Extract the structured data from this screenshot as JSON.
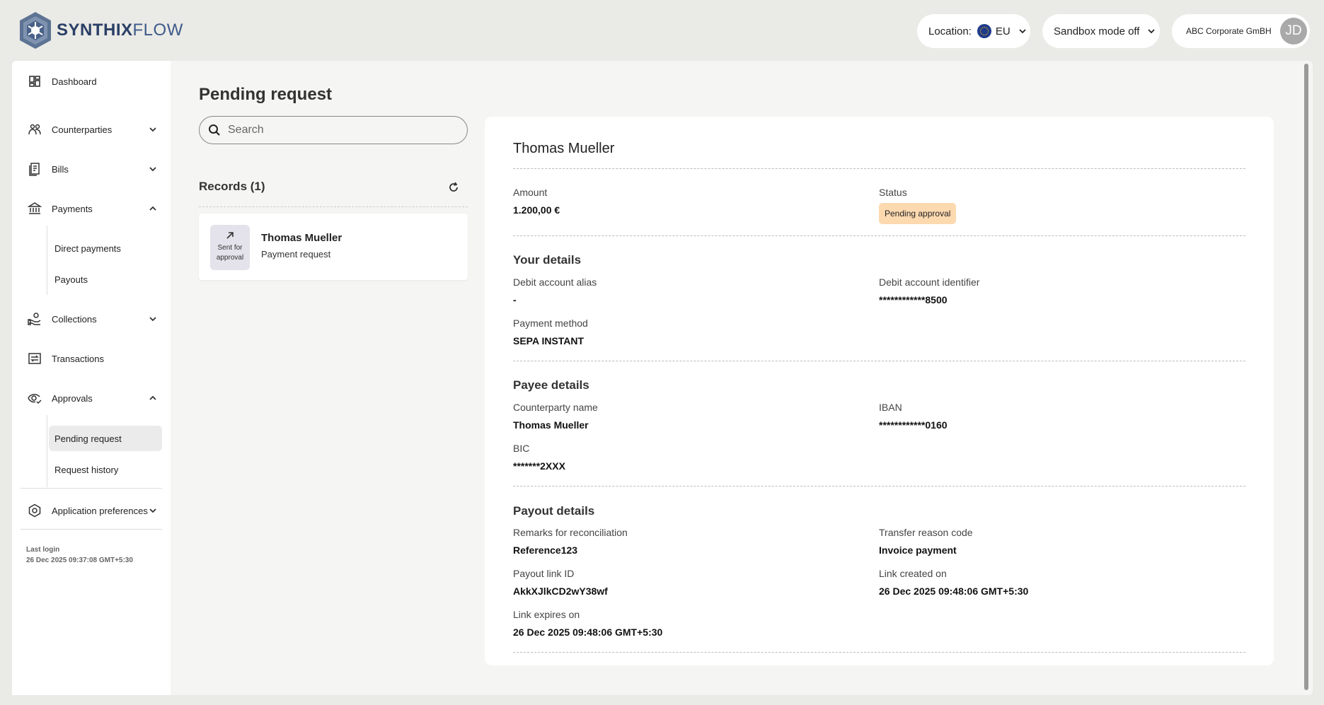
{
  "brand": {
    "name_bold": "SYNTHIX",
    "name_light": "FLOW"
  },
  "topbar": {
    "location_label": "Location:",
    "location_value": "EU",
    "sandbox_label": "Sandbox mode off",
    "company": "ABC Corporate GmBH",
    "avatar_initials": "JD"
  },
  "sidebar": {
    "dashboard": "Dashboard",
    "counterparties": "Counterparties",
    "bills": "Bills",
    "payments": "Payments",
    "payments_sub": [
      "Direct payments",
      "Payouts"
    ],
    "collections": "Collections",
    "transactions": "Transactions",
    "approvals": "Approvals",
    "approvals_sub": [
      "Pending request",
      "Request history"
    ],
    "app_prefs": "Application preferences",
    "last_login_label": "Last login",
    "last_login_value": "26 Dec 2025 09:37:08 GMT+5:30"
  },
  "main": {
    "title": "Pending request",
    "search_placeholder": "Search",
    "records_title": "Records (1)",
    "record": {
      "badge": "Sent for approval",
      "name": "Thomas Mueller",
      "type": "Payment request"
    }
  },
  "detail": {
    "name": "Thomas Mueller",
    "amount_label": "Amount",
    "amount_value": "1.200,00 €",
    "status_label": "Status",
    "status_value": "Pending approval",
    "your_details": {
      "heading": "Your details",
      "debit_alias_label": "Debit account alias",
      "debit_alias_value": "-",
      "debit_id_label": "Debit account identifier",
      "debit_id_value": "************8500",
      "method_label": "Payment method",
      "method_value": "SEPA INSTANT"
    },
    "payee_details": {
      "heading": "Payee details",
      "cp_name_label": "Counterparty name",
      "cp_name_value": "Thomas Mueller",
      "iban_label": "IBAN",
      "iban_value": "************0160",
      "bic_label": "BIC",
      "bic_value": "*******2XXX"
    },
    "payout_details": {
      "heading": "Payout details",
      "remarks_label": "Remarks for reconciliation",
      "remarks_value": "Reference123",
      "reason_label": "Transfer reason code",
      "reason_value": "Invoice payment",
      "link_id_label": "Payout link ID",
      "link_id_value": "AkkXJlkCD2wY38wf",
      "created_label": "Link created on",
      "created_value": "26 Dec 2025 09:48:06 GMT+5:30",
      "expires_label": "Link expires on",
      "expires_value": "26 Dec 2025 09:48:06 GMT+5:30"
    }
  },
  "colors": {
    "status_badge": "#fdd9b0",
    "brand": "#2a3f66",
    "background": "#eaeae6"
  }
}
